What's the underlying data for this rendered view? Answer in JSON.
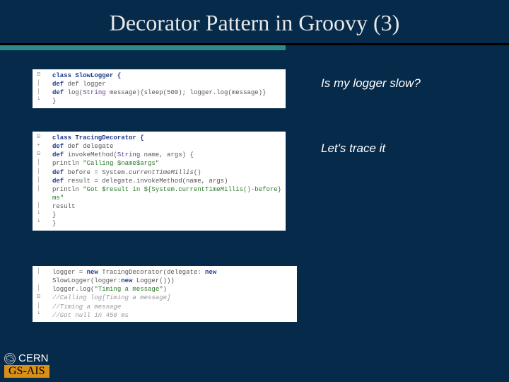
{
  "title": "Decorator Pattern in Groovy (3)",
  "annotations": {
    "a1": "Is my logger slow?",
    "a2": "Let's trace it"
  },
  "code1": {
    "l1": "class SlowLogger {",
    "l2": "def logger",
    "l3_a": "def log(String message){sleep(",
    "l3_b": "500",
    "l3_c": "); logger.log(message)}",
    "l4": "}"
  },
  "code2": {
    "l1": "class TracingDecorator {",
    "l2": "def delegate",
    "l3": "def invokeMethod(String name, args) {",
    "l4_a": "println ",
    "l4_b": "\"Calling $name$args\"",
    "l5": "def before = System.currentTimeMillis()",
    "l6": "def result = delegate.invokeMethod(name, args)",
    "l7_a": "println ",
    "l7_b": "\"Got $result in ${System.currentTimeMillis()-before} ms\"",
    "l8": "result",
    "l9": "}",
    "l10": "}"
  },
  "code3": {
    "l1_a": "logger = ",
    "l1_b": "new",
    "l1_c": " TracingDecorator(delegate: ",
    "l1_d": "new",
    "l1_e": " SlowLogger(logger:",
    "l1_f": "new",
    "l1_g": " Logger()))",
    "l2_a": "logger.log(",
    "l2_b": "\"Timing a message\"",
    "l2_c": ")",
    "l3": "//Calling log[Timing a message]",
    "l4": "//Timing a message",
    "l5": "//Got null in 450 ms"
  },
  "footer": {
    "org": "CERN",
    "dept": "GS-AIS"
  },
  "gutter": {
    "collapse": "⊟",
    "expand_dot": "•",
    "bar": "│",
    "corner": "└"
  }
}
